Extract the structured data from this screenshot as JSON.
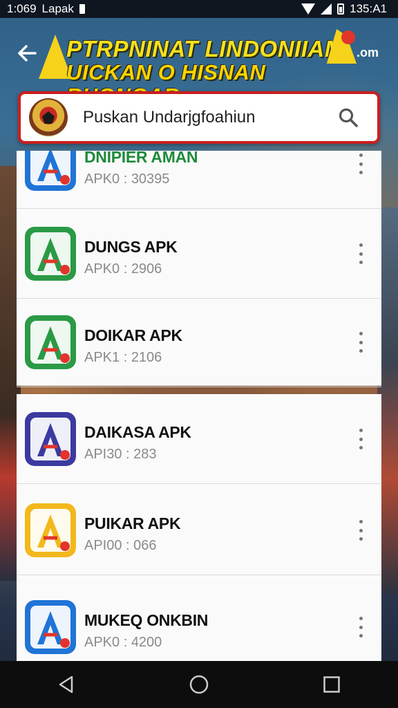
{
  "status_bar": {
    "left_time": "1:069",
    "left_label": "Lapak",
    "right_time": "135:A1"
  },
  "header": {
    "title_line1": "PTRPNINAT LINDONIIAM",
    "title_line2": "UICKAN O HISNAN RHONOAR",
    "brand_suffix": ".om"
  },
  "search": {
    "value": "Puskan Undarjgfoahiun"
  },
  "apps": [
    {
      "name": "DNIPIER AMAN",
      "version": "APK0 : 30395",
      "icon_color": "#1f74d6",
      "name_color": "#1e8a3a"
    },
    {
      "name": "DUNGS APK",
      "version": "APK0 : 2906",
      "icon_color": "#2a9a45",
      "name_color": "#111111"
    },
    {
      "name": "DOIKAR APK",
      "version": "APK1 : 2106",
      "icon_color": "#2a9a45",
      "name_color": "#111111"
    },
    {
      "name": "DAIKASA APK",
      "version": "API30 : 283",
      "icon_color": "#3c3aa0",
      "name_color": "#111111"
    },
    {
      "name": "PUIKAR APK",
      "version": "API00 : 066",
      "icon_color": "#f2b81c",
      "name_color": "#111111"
    },
    {
      "name": "MUKEQ ONKBIN",
      "version": "APK0 : 4200",
      "icon_color": "#1f74d6",
      "name_color": "#111111"
    }
  ],
  "icons": {
    "back": "arrow-left-icon",
    "search": "search-icon",
    "more": "more-vert-icon",
    "nav_back": "triangle-back-icon",
    "nav_home": "circle-home-icon",
    "nav_recents": "square-recents-icon"
  }
}
